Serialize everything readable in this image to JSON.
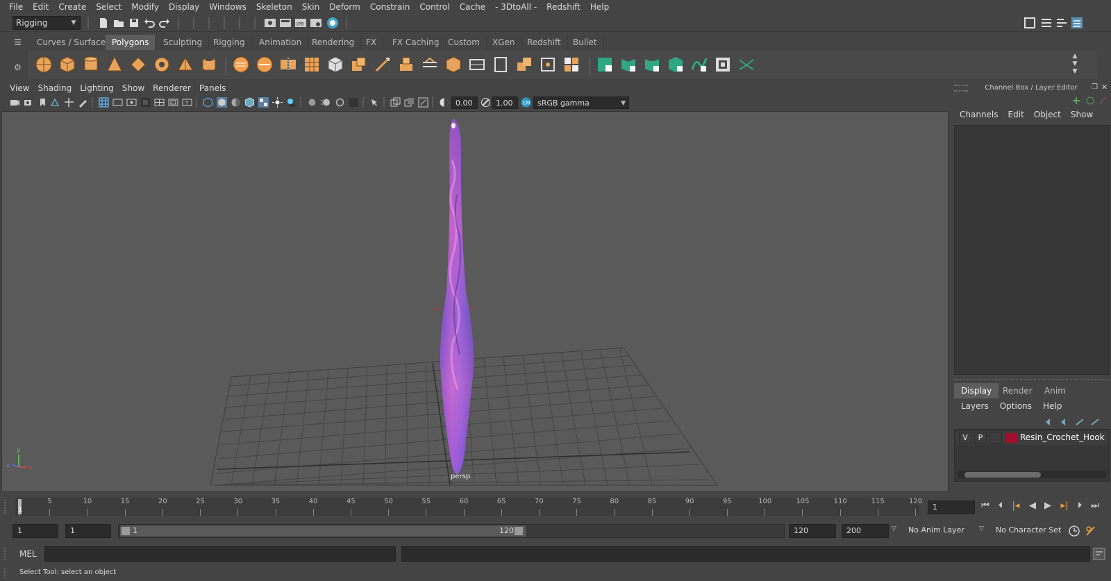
{
  "menubar": {
    "items": [
      "File",
      "Edit",
      "Create",
      "Select",
      "Modify",
      "Display",
      "Windows",
      "Skeleton",
      "Skin",
      "Deform",
      "Constrain",
      "Control",
      "Cache",
      "- 3DtoAll -",
      "Redshift",
      "Help"
    ]
  },
  "statusline": {
    "menuset": "Rigging"
  },
  "shelf": {
    "tabs": [
      "Curves / Surfaces",
      "Polygons",
      "Sculpting",
      "Rigging",
      "Animation",
      "Rendering",
      "FX",
      "FX Caching",
      "Custom",
      "XGen",
      "Redshift",
      "Bullet"
    ],
    "active_tab": "Polygons"
  },
  "viewport": {
    "menu": [
      "View",
      "Shading",
      "Lighting",
      "Show",
      "Renderer",
      "Panels"
    ],
    "exposure": "0.00",
    "gamma": "1.00",
    "colorspace": "sRGB gamma",
    "camera_label": "persp",
    "axis_x": "x",
    "axis_y": "y",
    "axis_z": "z"
  },
  "channelbox": {
    "title": "Channel Box / Layer Editor",
    "menu": [
      "Channels",
      "Edit",
      "Object",
      "Show"
    ],
    "tabs": [
      "Display",
      "Render",
      "Anim"
    ],
    "active_tab": "Display",
    "layer_menu": [
      "Layers",
      "Options",
      "Help"
    ],
    "layer": {
      "v": "V",
      "p": "P",
      "name": "Resin_Crochet_Hook",
      "color": "#a0102c"
    }
  },
  "timeline": {
    "ticks": [
      "1",
      "5",
      "10",
      "15",
      "20",
      "25",
      "30",
      "35",
      "40",
      "45",
      "50",
      "55",
      "60",
      "65",
      "70",
      "75",
      "80",
      "85",
      "90",
      "95",
      "100",
      "105",
      "110",
      "115",
      "120"
    ],
    "current_frame": "1",
    "current_marker": "1"
  },
  "range": {
    "start": "1",
    "anim_start": "1",
    "slider_start": "1",
    "slider_end": "120",
    "end": "120",
    "anim_end": "200",
    "anim_layer": "No Anim Layer",
    "char_set": "No Character Set"
  },
  "cmdline": {
    "label": "MEL"
  },
  "helpline": {
    "text": "Select Tool: select an object"
  }
}
